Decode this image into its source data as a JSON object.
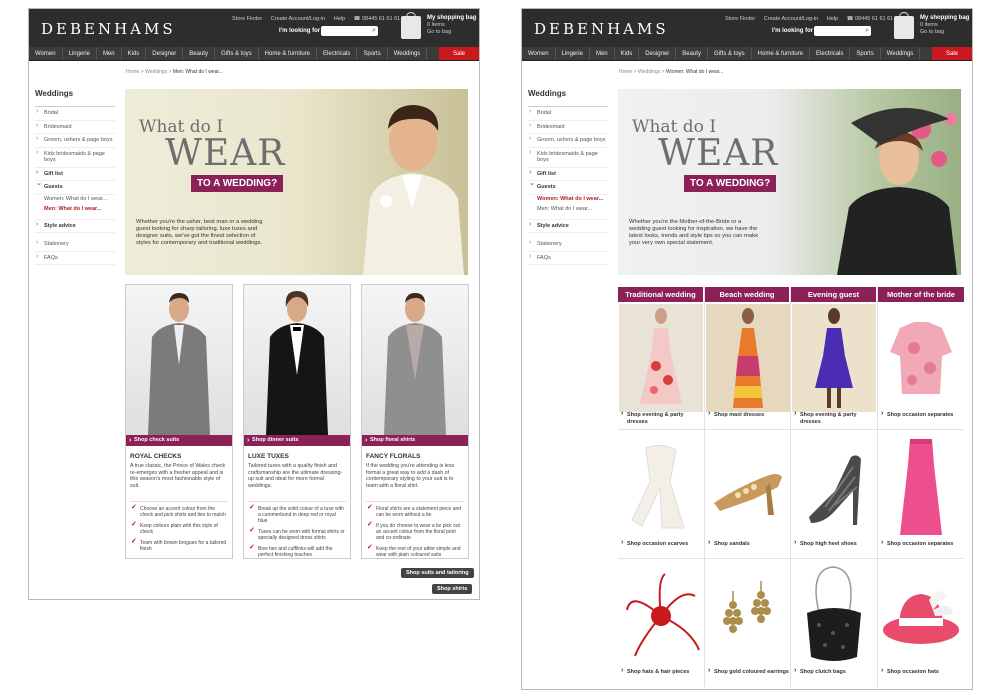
{
  "brand": "DEBENHAMS",
  "header": {
    "util_links": [
      "Store Finder",
      "Create Account/Log-in",
      "Help",
      "08445 61 61 61"
    ],
    "looking_for": "I'm looking for",
    "bag_title": "My shopping bag",
    "bag_items": "0 items",
    "bag_link": "Go to bag"
  },
  "nav": [
    "Women",
    "Lingerie",
    "Men",
    "Kids",
    "Designer",
    "Beauty",
    "Gifts & toys",
    "Home & furniture",
    "Electricals",
    "Sports",
    "Weddings",
    "Sale"
  ],
  "sidebar": {
    "title": "Weddings",
    "bridal": "Bridal",
    "bridesmaid": "Bridesmaid",
    "groom": "Groom, ushers & page boys",
    "kids": "Kids bridesmaids & page boys",
    "gift": "Gift list",
    "guests": "Guests",
    "women": "Women: What do I wear...",
    "men": "Men: What do I wear...",
    "style": "Style advice",
    "stationery": "Stationery",
    "faqs": "FAQs"
  },
  "hero": {
    "what": "What do I",
    "wear": "WEAR",
    "wedding": "TO A WEDDING?"
  },
  "left": {
    "breadcrumb_home": "Home",
    "breadcrumb_sep": ">",
    "breadcrumb_section": "Weddings",
    "breadcrumb_current": "Men: What do I wear...",
    "hero_copy": "Whether you're the usher, best man or a wedding guest looking for sharp tailoring, luxe tuxes and designer suits, we've got the finest selection of styles for contemporary and traditional weddings.",
    "columns": [
      {
        "bar": "Shop check suits",
        "title": "ROYAL CHECKS",
        "desc": "A true classic, the Prince of Wales check re-emerges with a fresher appeal and is this season's most fashionable style of suit.",
        "tips": [
          "Choose an accent colour from the check and pick shirts and ties to match",
          "Keep colours plain with this style of check",
          "Team with brown brogues for a tailored finish"
        ]
      },
      {
        "bar": "Shop dinner suits",
        "title": "LUXE TUXES",
        "desc": "Tailored tuxes with a quality finish and craftsmanship are the ultimate dressing-up suit and ideal for more formal weddings.",
        "tips": [
          "Break up the solid colour of a tuxe with a cummerbund in deep red or royal blue",
          "Tuxes can be worn with formal shirts or specially designed dress shirts",
          "Bow ties and cufflinks will add the perfect finishing touches"
        ]
      },
      {
        "bar": "Shop floral shirts",
        "title": "FANCY FLORALS",
        "desc": "If the wedding you're attending is less formal a great way to add a dash of contemporary styling to your suit is to team with a floral shirt.",
        "tips": [
          "Floral shirts are a statement piece and can be worn without a tie",
          "If you do choose to wear a tie pick out an accent colour from the floral print and co-ordinate",
          "Keep the rest of your attire simple and wear with plain coloured suits"
        ]
      }
    ],
    "btn_suits": "Shop suits and tailoring",
    "btn_shirts": "Shop shirts"
  },
  "right": {
    "breadcrumb_home": "Home",
    "breadcrumb_sep": ">",
    "breadcrumb_section": "Weddings",
    "breadcrumb_current": "Women: What do I wear...",
    "hero_copy": "Whether you're the Mother-of-the-Bride or a wedding guest looking for inspiration, we have the latest looks, trends and style tips so you can make your very own special statement.",
    "headers": [
      "Traditional wedding",
      "Beach wedding",
      "Evening guest",
      "Mother of the bride"
    ],
    "cells": [
      "Shop evening & party dresses",
      "Shop maxi dresses",
      "Shop evening & party dresses",
      "Shop occasion separates",
      "Shop occasion scarves",
      "Shop sandals",
      "Shop high heel shoes",
      "Shop occasion separates",
      "Shop hats & hair pieces",
      "Shop gold coloured earrings",
      "Shop clutch bags",
      "Shop occasion hats"
    ]
  },
  "colors": {
    "accent": "#8b2157",
    "sale": "#c8191f",
    "header": "#2d2d2d",
    "active": "#b01e22"
  }
}
